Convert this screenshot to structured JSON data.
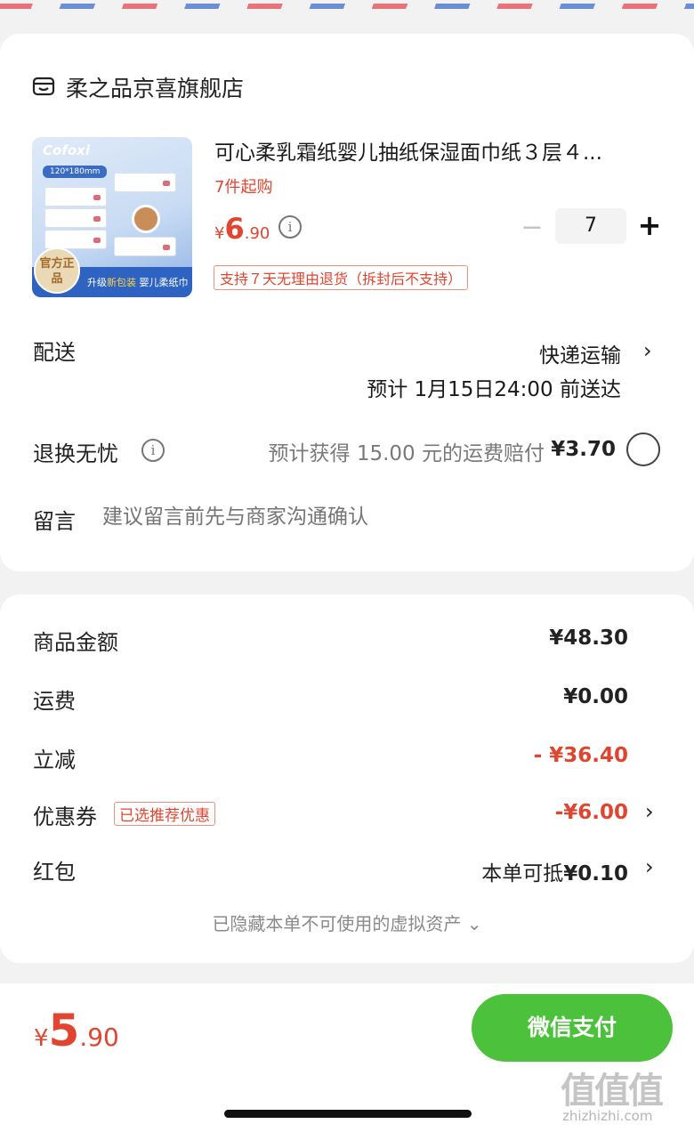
{
  "shop": {
    "name": "柔之品京喜旗舰店",
    "icon": "shop-icon"
  },
  "product": {
    "brand_logo": "Cofoxi",
    "image_size_label": "120*180mm",
    "image_badge": "官方正品",
    "image_banner_prefix": "升级",
    "image_banner_highlight": "新包装",
    "image_banner_suffix": "婴儿柔纸巾",
    "title": "可心柔乳霜纸婴儿抽纸保湿面巾纸３层４...",
    "min_purchase": "7件起购",
    "price_currency": "¥",
    "price_integer": "6",
    "price_decimal": ".90",
    "quantity": "7",
    "minus_label": "−",
    "plus_label": "+",
    "return_policy": "支持７天无理由退货（拆封后不支持）"
  },
  "delivery": {
    "label": "配送",
    "method": "快递运输",
    "eta": "预计 1月15日24:00 前送达"
  },
  "return_insurance": {
    "label": "退换无忧",
    "text": "预计获得 15.00 元的运费赔付",
    "price": "¥3.70"
  },
  "message": {
    "label": "留言",
    "placeholder": "建议留言前先与商家沟通确认"
  },
  "summary": {
    "goods_label": "商品金额",
    "goods_value": "¥48.30",
    "shipping_label": "运费",
    "shipping_value": "¥0.00",
    "discount_label": "立减",
    "discount_value": "- ¥36.40",
    "coupon_label": "优惠券",
    "coupon_tag": "已选推荐优惠",
    "coupon_value": "-¥6.00",
    "redpacket_label": "红包",
    "redpacket_prefix": "本单可抵",
    "redpacket_value": "¥0.10",
    "hidden_assets": "已隐藏本单不可使用的虚拟资产 ⌄"
  },
  "footer": {
    "total_currency": "¥",
    "total_integer": "5",
    "total_decimal": ".90",
    "pay_button": "微信支付"
  },
  "watermark": {
    "logo": "值值值",
    "url": "zhizhizhi.com"
  },
  "colors": {
    "accent_red": "#e1452f",
    "pay_green": "#4cc23c",
    "airmail_red": "#e8747a",
    "airmail_blue": "#6b8fd6"
  }
}
